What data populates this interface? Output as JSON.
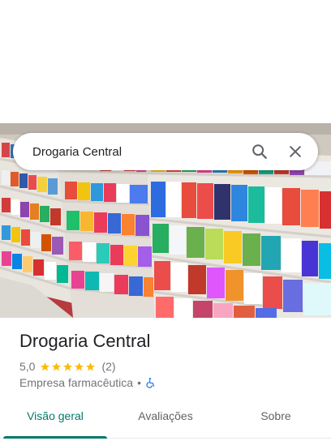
{
  "search": {
    "query": "Drogaria Central"
  },
  "place": {
    "name": "Drogaria Central",
    "rating": "5,0",
    "stars": 5,
    "review_count": "(2)",
    "category": "Empresa farmacêutica",
    "separator": "•"
  },
  "tabs": [
    {
      "label": "Visão geral",
      "active": true
    },
    {
      "label": "Avaliações",
      "active": false
    },
    {
      "label": "Sobre",
      "active": false
    }
  ],
  "colors": {
    "accent": "#00796b",
    "star": "#fbbc04",
    "accessibility_icon": "#1a73e8"
  },
  "icons": {
    "search": "search-icon",
    "close": "close-icon",
    "accessibility": "wheelchair-icon",
    "star": "star-icon"
  }
}
